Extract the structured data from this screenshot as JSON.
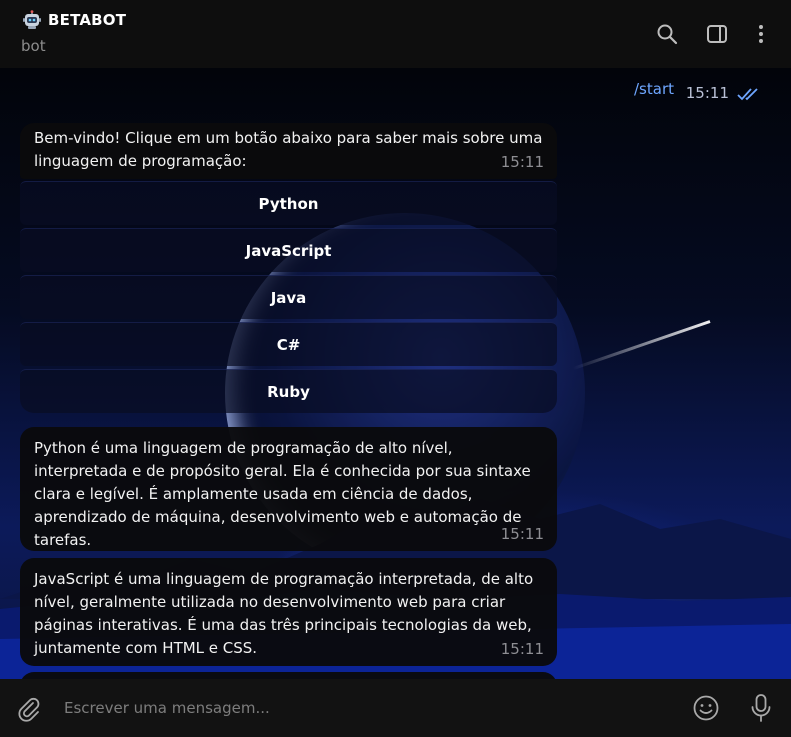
{
  "header": {
    "title": "BETABOT",
    "subtitle": "bot",
    "icons": [
      "search-icon",
      "sidebar-toggle-icon",
      "more-vertical-icon"
    ]
  },
  "outgoing": {
    "text": "/start",
    "time": "15:11",
    "status_icon": "double-check-icon"
  },
  "messages": [
    {
      "text": "Bem-vindo! Clique em um botão abaixo para saber mais sobre uma linguagem de programação:",
      "time": "15:11"
    },
    {
      "text": "Python é uma linguagem de programação de alto nível, interpretada e de propósito geral. Ela é conhecida por sua sintaxe clara e legível. É amplamente usada em ciência de dados, aprendizado de máquina, desenvolvimento web e automação de tarefas.",
      "time": "15:11"
    },
    {
      "text": "JavaScript é uma linguagem de programação interpretada, de alto nível, geralmente utilizada no desenvolvimento web para criar páginas interativas. É uma das três principais tecnologias da web, juntamente com HTML e CSS.",
      "time": "15:11"
    }
  ],
  "keyboard": {
    "buttons": [
      "Python",
      "JavaScript",
      "Java",
      "C#",
      "Ruby"
    ]
  },
  "composer": {
    "placeholder": "Escrever uma mensagem...",
    "icons": [
      "attach-icon",
      "emoji-icon",
      "microphone-icon"
    ]
  },
  "colors": {
    "accent": "#6ea6ff",
    "bubble": "#0a0a0c",
    "header": "#0e0e0e",
    "composer": "#121212"
  }
}
